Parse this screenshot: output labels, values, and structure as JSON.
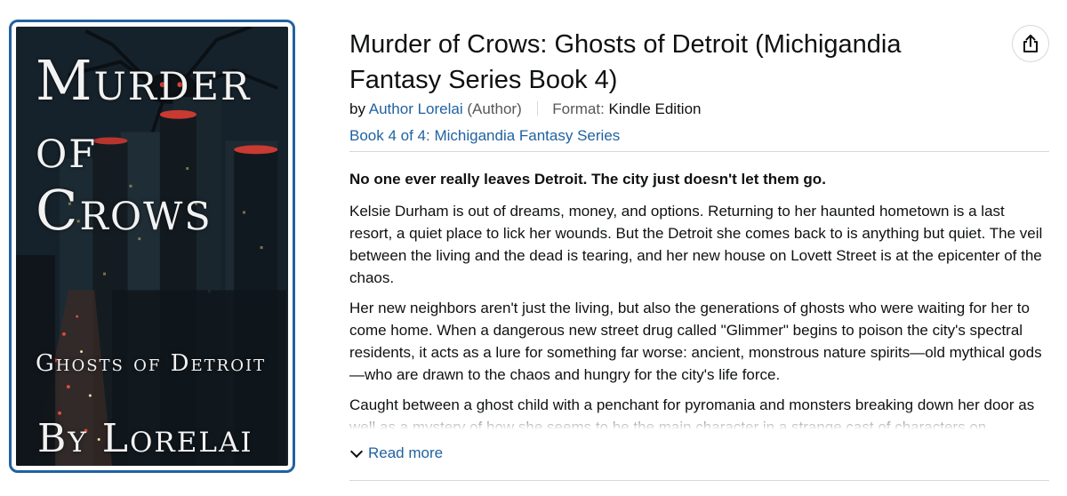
{
  "cover": {
    "title_line1": "Murder",
    "title_line2": "of",
    "title_line3": "Crows",
    "subtitle": "Ghosts of Detroit",
    "byline": "By Lorelai"
  },
  "product": {
    "title": "Murder of Crows: Ghosts of Detroit (Michigandia Fantasy Series Book 4)",
    "by_prefix": "by",
    "author_name": "Author Lorelai",
    "author_role": "(Author)",
    "format_label": "Format:",
    "format_value": "Kindle Edition",
    "series_link": "Book 4 of 4: Michigandia Fantasy Series"
  },
  "description": {
    "lead": "No one ever really leaves Detroit. The city just doesn't let them go.",
    "paragraphs": [
      "Kelsie Durham is out of dreams, money, and options. Returning to her haunted hometown is a last resort, a quiet place to lick her wounds. But the Detroit she comes back to is anything but quiet. The veil between the living and the dead is tearing, and her new house on Lovett Street is at the epicenter of the chaos.",
      "Her new neighbors aren't just the living, but also the generations of ghosts who were waiting for her to come home. When a dangerous new street drug called \"Glimmer\" begins to poison the city's spectral residents, it acts as a lure for something far worse: ancient, monstrous nature spirits—old mythical gods—who are drawn to the chaos and hungry for the city's life force.",
      "Caught between a ghost child with a penchant for pyromania and monsters breaking down her door as well as a mystery of how she seems to be the main character in a strange cast of characters on"
    ],
    "read_more": "Read more"
  },
  "icons": {
    "share": "share-icon",
    "chevron": "chevron-down-icon"
  },
  "colors": {
    "link": "#2162a1",
    "cover_border": "#2162a1",
    "text": "#0f1111"
  }
}
